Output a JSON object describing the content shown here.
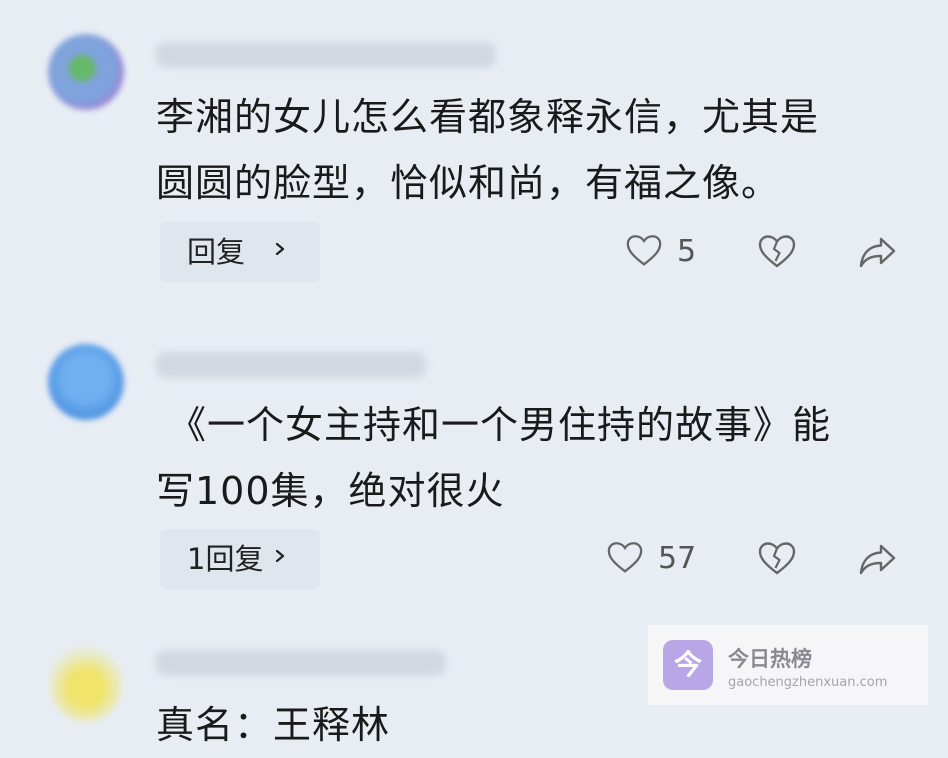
{
  "comments": [
    {
      "text_line1": "李湘的女儿怎么看都象释永信，尤其是",
      "text_line2": "圆圆的脸型，恰似和尚，有福之像。",
      "reply_label": "回复",
      "like_count": "5",
      "avatar_color": "#7aa0d8"
    },
    {
      "text_line1": "《一个女主持和一个男住持的故事》能",
      "text_line2": "写100集，绝对很火",
      "reply_label": "1回复",
      "like_count": "57",
      "avatar_color": "#5a9be6"
    },
    {
      "text_line1": "真名：王释林",
      "avatar_color": "#e6e09a"
    }
  ],
  "icons": {
    "like": "heart-outline-icon",
    "dislike": "broken-heart-icon",
    "share": "share-arrow-icon",
    "reply_chevron": "chevron-right-icon"
  },
  "watermark": {
    "logo_glyph": "今",
    "title": "今日热榜",
    "subtitle": "gaochengzhenxuan.com"
  }
}
